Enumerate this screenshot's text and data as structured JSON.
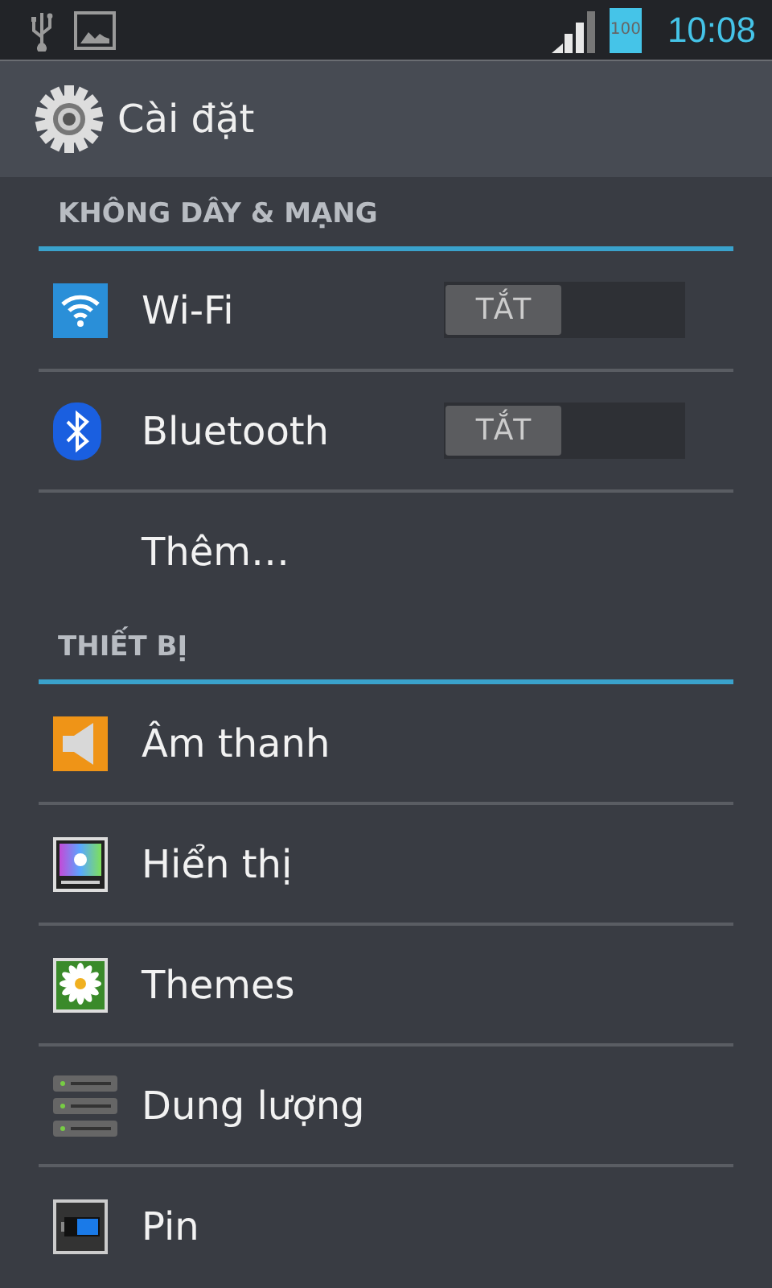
{
  "status_bar": {
    "battery": "100",
    "time": "10:08"
  },
  "action_bar": {
    "title": "Cài đặt"
  },
  "sections": [
    {
      "title": "KHÔNG DÂY & MẠNG",
      "items": [
        {
          "kind": "toggle",
          "label": "Wi-Fi",
          "switch": {
            "text": "TẮT",
            "on": false
          }
        },
        {
          "kind": "toggle",
          "label": "Bluetooth",
          "switch": {
            "text": "TẮT",
            "on": false
          }
        },
        {
          "kind": "link",
          "label": "Thêm…"
        }
      ]
    },
    {
      "title": "THIẾT BỊ",
      "items": [
        {
          "kind": "link",
          "label": "Âm thanh"
        },
        {
          "kind": "link",
          "label": "Hiển thị"
        },
        {
          "kind": "link",
          "label": "Themes"
        },
        {
          "kind": "link",
          "label": "Dung lượng"
        },
        {
          "kind": "link",
          "label": "Pin"
        }
      ]
    }
  ]
}
